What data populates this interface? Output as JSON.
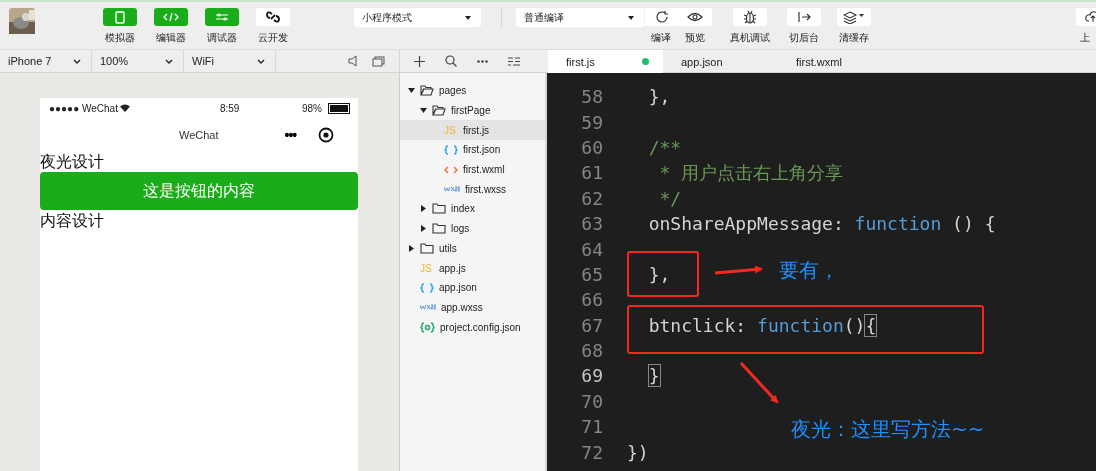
{
  "toolbar": {
    "left_buttons": [
      {
        "label": "模拟器",
        "active": true
      },
      {
        "label": "编辑器",
        "active": true
      },
      {
        "label": "调试器",
        "active": true
      },
      {
        "label": "云开发",
        "active": false
      }
    ],
    "mode_select": "小程序模式",
    "compile_select": "普通编译",
    "right_buttons": [
      {
        "label": "编译"
      },
      {
        "label": "预览"
      },
      {
        "label": "真机调试"
      },
      {
        "label": "切后台"
      },
      {
        "label": "清缓存"
      },
      {
        "label": "上"
      }
    ]
  },
  "sim_bar": {
    "device": "iPhone 7",
    "zoom": "100%",
    "network": "WiFi"
  },
  "tabs": [
    {
      "label": "first.js",
      "selected": true,
      "modified": true
    },
    {
      "label": "app.json",
      "selected": false,
      "modified": false
    },
    {
      "label": "first.wxml",
      "selected": false,
      "modified": false
    }
  ],
  "phone": {
    "carrier": "●●●●● WeChat",
    "time": "8:59",
    "battery": "98%",
    "nav_title": "WeChat",
    "nav_more": "•••",
    "content": [
      {
        "kind": "text",
        "text": "夜光设计"
      },
      {
        "kind": "button",
        "text": "这是按钮的内容"
      },
      {
        "kind": "text",
        "text": "内容设计"
      }
    ]
  },
  "file_tree": [
    {
      "name": "pages",
      "kind": "folder",
      "expanded": true,
      "children": [
        {
          "name": "firstPage",
          "kind": "folder",
          "expanded": true,
          "children": [
            {
              "name": "first.js",
              "kind": "js",
              "badge": "JS",
              "selected": true
            },
            {
              "name": "first.json",
              "kind": "json",
              "selected": false
            },
            {
              "name": "first.wxml",
              "kind": "wxml",
              "selected": false
            },
            {
              "name": "first.wxss",
              "kind": "wxss",
              "selected": false
            }
          ]
        },
        {
          "name": "index",
          "kind": "folder",
          "expanded": false
        },
        {
          "name": "logs",
          "kind": "folder",
          "expanded": false
        }
      ]
    },
    {
      "name": "utils",
      "kind": "folder",
      "expanded": false
    },
    {
      "name": "app.js",
      "kind": "js",
      "badge": "JS",
      "selected": false
    },
    {
      "name": "app.json",
      "kind": "json",
      "selected": false
    },
    {
      "name": "app.wxss",
      "kind": "wxss",
      "selected": false
    },
    {
      "name": "project.config.json",
      "kind": "config",
      "selected": false
    }
  ],
  "code": [
    {
      "number": "58",
      "current": false,
      "tokens": [
        {
          "text": "  },",
          "kind": "plain"
        }
      ]
    },
    {
      "number": "59",
      "current": false
    },
    {
      "number": "60",
      "current": false,
      "tokens": [
        {
          "text": "  /**",
          "kind": "comment"
        }
      ]
    },
    {
      "number": "61",
      "current": false,
      "tokens": [
        {
          "text": "   * 用户点击右上角分享",
          "kind": "comment"
        }
      ]
    },
    {
      "number": "62",
      "current": false,
      "tokens": [
        {
          "text": "   */",
          "kind": "comment"
        }
      ]
    },
    {
      "number": "63",
      "current": false,
      "tokens": [
        {
          "text": "  onShareAppMessage: ",
          "kind": "plain"
        },
        {
          "text": "function",
          "kind": "keyword"
        },
        {
          "text": " () {",
          "kind": "plain"
        }
      ]
    },
    {
      "number": "64",
      "current": false
    },
    {
      "number": "65",
      "current": false,
      "tokens": [
        {
          "text": "  },",
          "kind": "plain"
        }
      ]
    },
    {
      "number": "66",
      "current": false
    },
    {
      "number": "67",
      "current": false,
      "tokens": [
        {
          "text": "  btnclick: ",
          "kind": "plain"
        },
        {
          "text": "function",
          "kind": "keyword"
        },
        {
          "text": "()",
          "kind": "plain"
        },
        {
          "text": "{",
          "kind": "match"
        }
      ]
    },
    {
      "number": "68",
      "current": false
    },
    {
      "number": "69",
      "current": true,
      "tokens": [
        {
          "text": "  }",
          "kind": "match"
        }
      ]
    },
    {
      "number": "70",
      "current": false
    },
    {
      "number": "71",
      "current": false
    },
    {
      "number": "72",
      "current": false,
      "tokens": [
        {
          "text": "})",
          "kind": "plain"
        }
      ]
    }
  ],
  "annotations": [
    {
      "kind": "box"
    },
    {
      "kind": "box"
    },
    {
      "kind": "arrow"
    },
    {
      "kind": "arrow"
    },
    {
      "kind": "note",
      "text": "要有，"
    },
    {
      "kind": "note",
      "text": "夜光：这里写方法~~"
    }
  ]
}
